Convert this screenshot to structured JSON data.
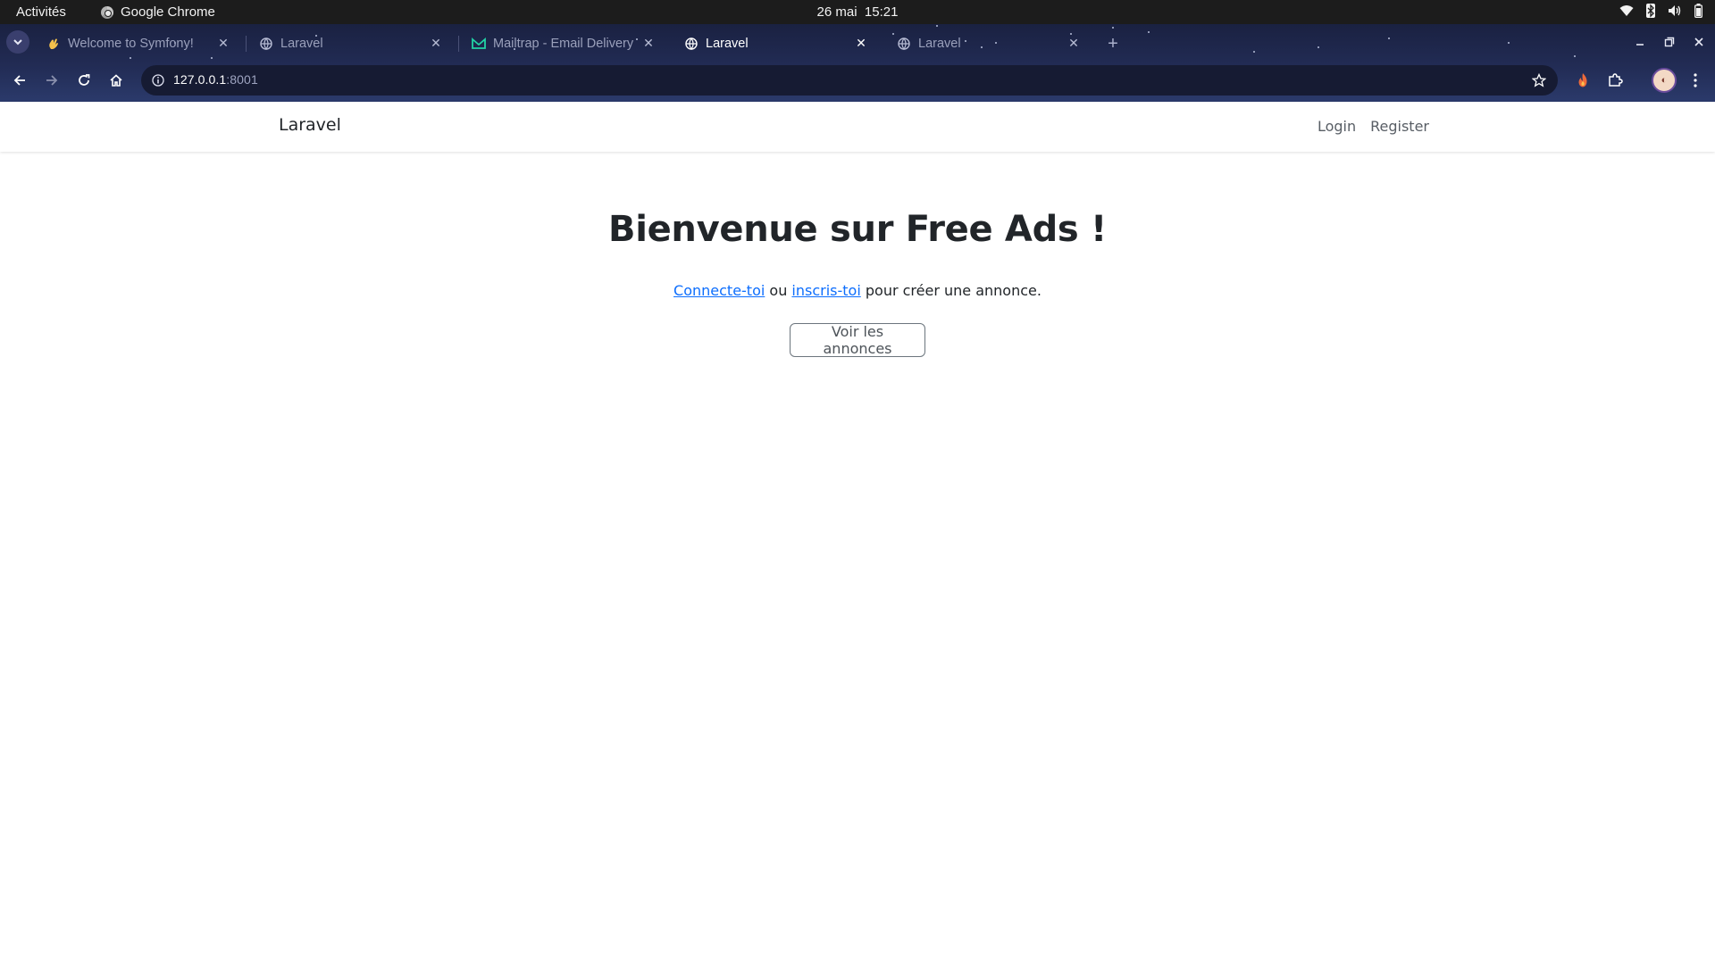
{
  "system_bar": {
    "activities": "Activités",
    "app_name": "Google Chrome",
    "date": "26 mai",
    "time": "15:21"
  },
  "browser": {
    "tabs": [
      {
        "title": "Welcome to Symfony!",
        "icon": "waving-hand-icon",
        "active": false
      },
      {
        "title": "Laravel",
        "icon": "globe-icon",
        "active": false
      },
      {
        "title": "Mailtrap - Email Delivery",
        "icon": "mailtrap-icon",
        "active": false
      },
      {
        "title": "Laravel",
        "icon": "globe-icon",
        "active": true
      },
      {
        "title": "Laravel",
        "icon": "globe-icon",
        "active": false
      }
    ],
    "url_host": "127.0.0.1",
    "url_port": ":8001",
    "theme_colors": {
      "frame": "#222c55",
      "omnibox": "#161b33"
    }
  },
  "site": {
    "brand": "Laravel",
    "nav": {
      "login": "Login",
      "register": "Register"
    },
    "heading": "Bienvenue sur Free Ads !",
    "lead_link_login": "Connecte-toi",
    "lead_mid": " ou ",
    "lead_link_register": "inscris-toi",
    "lead_tail": " pour créer une annonce.",
    "button": "Voir les annonces",
    "link_color": "#0d6efd"
  }
}
